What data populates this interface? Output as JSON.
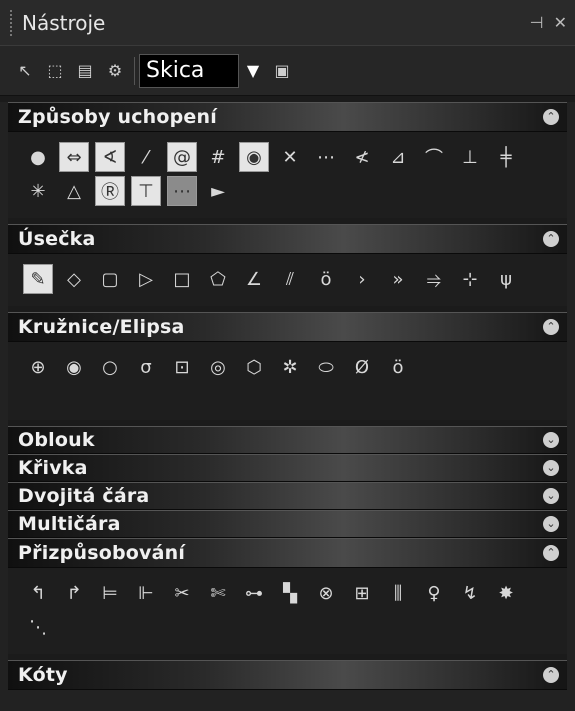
{
  "window": {
    "title": "Nástroje",
    "pin_icon": "pin-icon",
    "close_icon": "close-icon"
  },
  "toolbar": {
    "mode_value": "Skica",
    "tools": [
      "select-arrow-icon",
      "select-window-icon",
      "layer-icon",
      "gear-icon"
    ],
    "after_combo_icon": "properties-icon"
  },
  "sections": {
    "snaps": {
      "title": "Způsoby uchopení",
      "icons": [
        "snap-end-icon",
        "snap-mid-icon",
        "snap-center-icon",
        "snap-line-icon",
        "snap-quadrant-icon",
        "snap-grid-icon",
        "snap-node-icon",
        "snap-intersection-icon",
        "snap-grid2-icon",
        "snap-angle-icon",
        "snap-tangent-icon",
        "snap-arc-icon",
        "snap-perpendicular-icon",
        "snap-parallel-icon",
        "snap-star-icon",
        "snap-triangle-icon",
        "snap-on-icon",
        "snap-pick-icon",
        "snap-dashed-icon",
        "snap-cursor-icon"
      ]
    },
    "line": {
      "title": "Úsečka",
      "icons": [
        "pencil-icon",
        "line-free-icon",
        "line-rect-icon",
        "line-triangle-icon",
        "line-square-icon",
        "line-pentagon-icon",
        "line-angle-icon",
        "line-parallel-icon",
        "line-offset-icon",
        "line-tangent-icon",
        "line-tangent2-icon",
        "line-tangent3-icon",
        "line-bisect-icon",
        "line-perp-icon"
      ]
    },
    "circle": {
      "title": "Kružnice/Elipsa",
      "icons": [
        "circle-center-icon",
        "circle-fill-icon",
        "circle-icon",
        "circle-tangent-icon",
        "circle-square-icon",
        "circle-rounded-icon",
        "circle-hex-icon",
        "circle-star-icon",
        "ellipse-icon",
        "ellipse-tilt-icon",
        "circle-double-icon"
      ]
    },
    "arc": {
      "title": "Oblouk"
    },
    "curve": {
      "title": "Křivka"
    },
    "double_line": {
      "title": "Dvojitá čára"
    },
    "multiline": {
      "title": "Multičára"
    },
    "fit": {
      "title": "Přizpůsobování",
      "icons": [
        "trim-icon",
        "trim2-icon",
        "extend-icon",
        "extend2-icon",
        "break-icon",
        "break2-icon",
        "join-icon",
        "fillet-icon",
        "chamfer-icon",
        "scale-icon",
        "stretch-icon",
        "bulb-icon",
        "offset-icon",
        "explode-icon",
        "misc-icon"
      ]
    },
    "dimensions": {
      "title": "Kóty"
    }
  }
}
